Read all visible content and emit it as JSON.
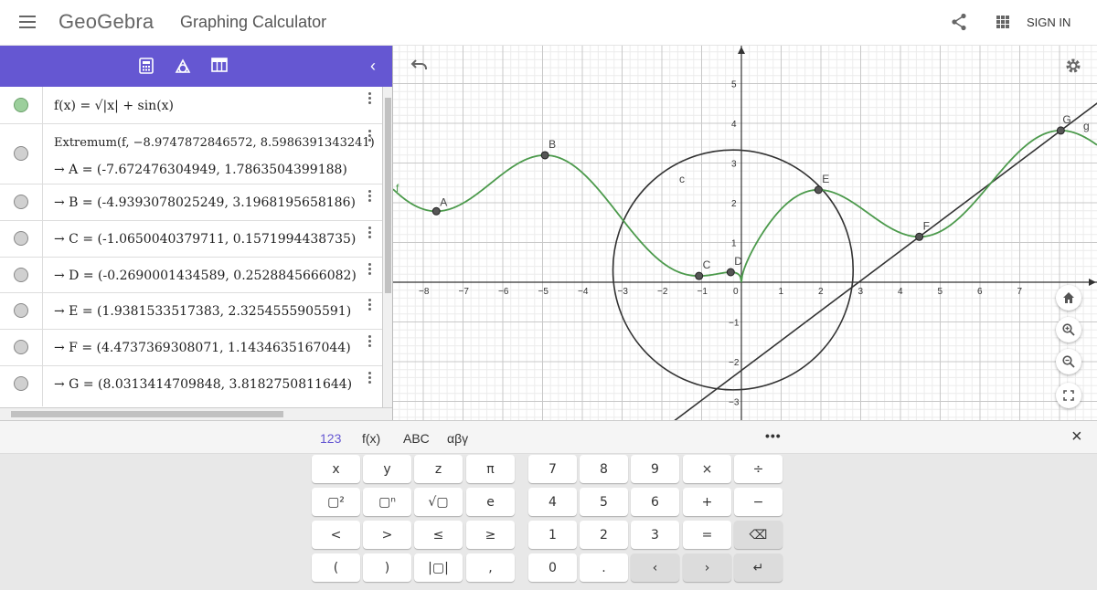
{
  "header": {
    "logo": "GeoGebra",
    "title": "Graphing Calculator",
    "sign_in": "SIGN IN"
  },
  "algebra": {
    "input_row": "f(x) = √|x| + sin(x)",
    "extremum_cmd": "Extremum(f, −8.9747872846572, 8.5986391343241)",
    "points": [
      "→  A = (-7.672476304949, 1.7863504399188)",
      "→  B = (-4.9393078025249, 3.1968195658186)",
      "→  C = (-1.0650040379711, 0.1571994438735)",
      "→  D = (-0.2690001434589, 0.2528845666082)",
      "→  E = (1.9381533517383, 2.3254555905591)",
      "→  F = (4.4737369308071, 1.1434635167044)",
      "→  G = (8.0313414709848, 3.8182750811644)"
    ]
  },
  "graph": {
    "x_ticks": [
      "−8",
      "−7",
      "−6",
      "−5",
      "−4",
      "−3",
      "−2",
      "−1",
      "0",
      "1",
      "2",
      "3",
      "4",
      "5",
      "6",
      "7"
    ],
    "y_ticks": [
      "5",
      "4",
      "3",
      "2",
      "1",
      "−1",
      "−2",
      "−3"
    ],
    "point_labels": [
      "A",
      "B",
      "C",
      "D",
      "E",
      "F",
      "G"
    ],
    "curve_labels": {
      "f": "f",
      "c": "c",
      "g": "g"
    },
    "points": [
      {
        "name": "A",
        "x": -7.672476304949,
        "y": 1.7863504399188
      },
      {
        "name": "B",
        "x": -4.9393078025249,
        "y": 3.1968195658186
      },
      {
        "name": "C",
        "x": -1.0650040379711,
        "y": 0.1571994438735
      },
      {
        "name": "D",
        "x": -0.2690001434589,
        "y": 0.2528845666082
      },
      {
        "name": "E",
        "x": 1.9381533517383,
        "y": 2.3254555905591
      },
      {
        "name": "F",
        "x": 4.4737369308071,
        "y": 1.1434635167044
      },
      {
        "name": "G",
        "x": 8.0313414709848,
        "y": 3.8182750811644
      }
    ],
    "function_color": "#4c9a4c",
    "object_color": "#333333"
  },
  "keyboard": {
    "tabs": [
      "123",
      "f(x)",
      "ABC",
      "αβγ"
    ],
    "more": "•••",
    "close": "×",
    "keys": [
      [
        "x",
        "y",
        "z",
        "π",
        "7",
        "8",
        "9",
        "×",
        "÷"
      ],
      [
        "▢²",
        "▢ⁿ",
        "√▢",
        "e",
        "4",
        "5",
        "6",
        "+",
        "−"
      ],
      [
        "<",
        ">",
        "≤",
        "≥",
        "1",
        "2",
        "3",
        "=",
        "⌫"
      ],
      [
        "(",
        ")",
        "|▢|",
        ",",
        "0",
        ".",
        "‹",
        "›",
        "↵"
      ]
    ]
  },
  "colors": {
    "accent": "#6557d2"
  }
}
